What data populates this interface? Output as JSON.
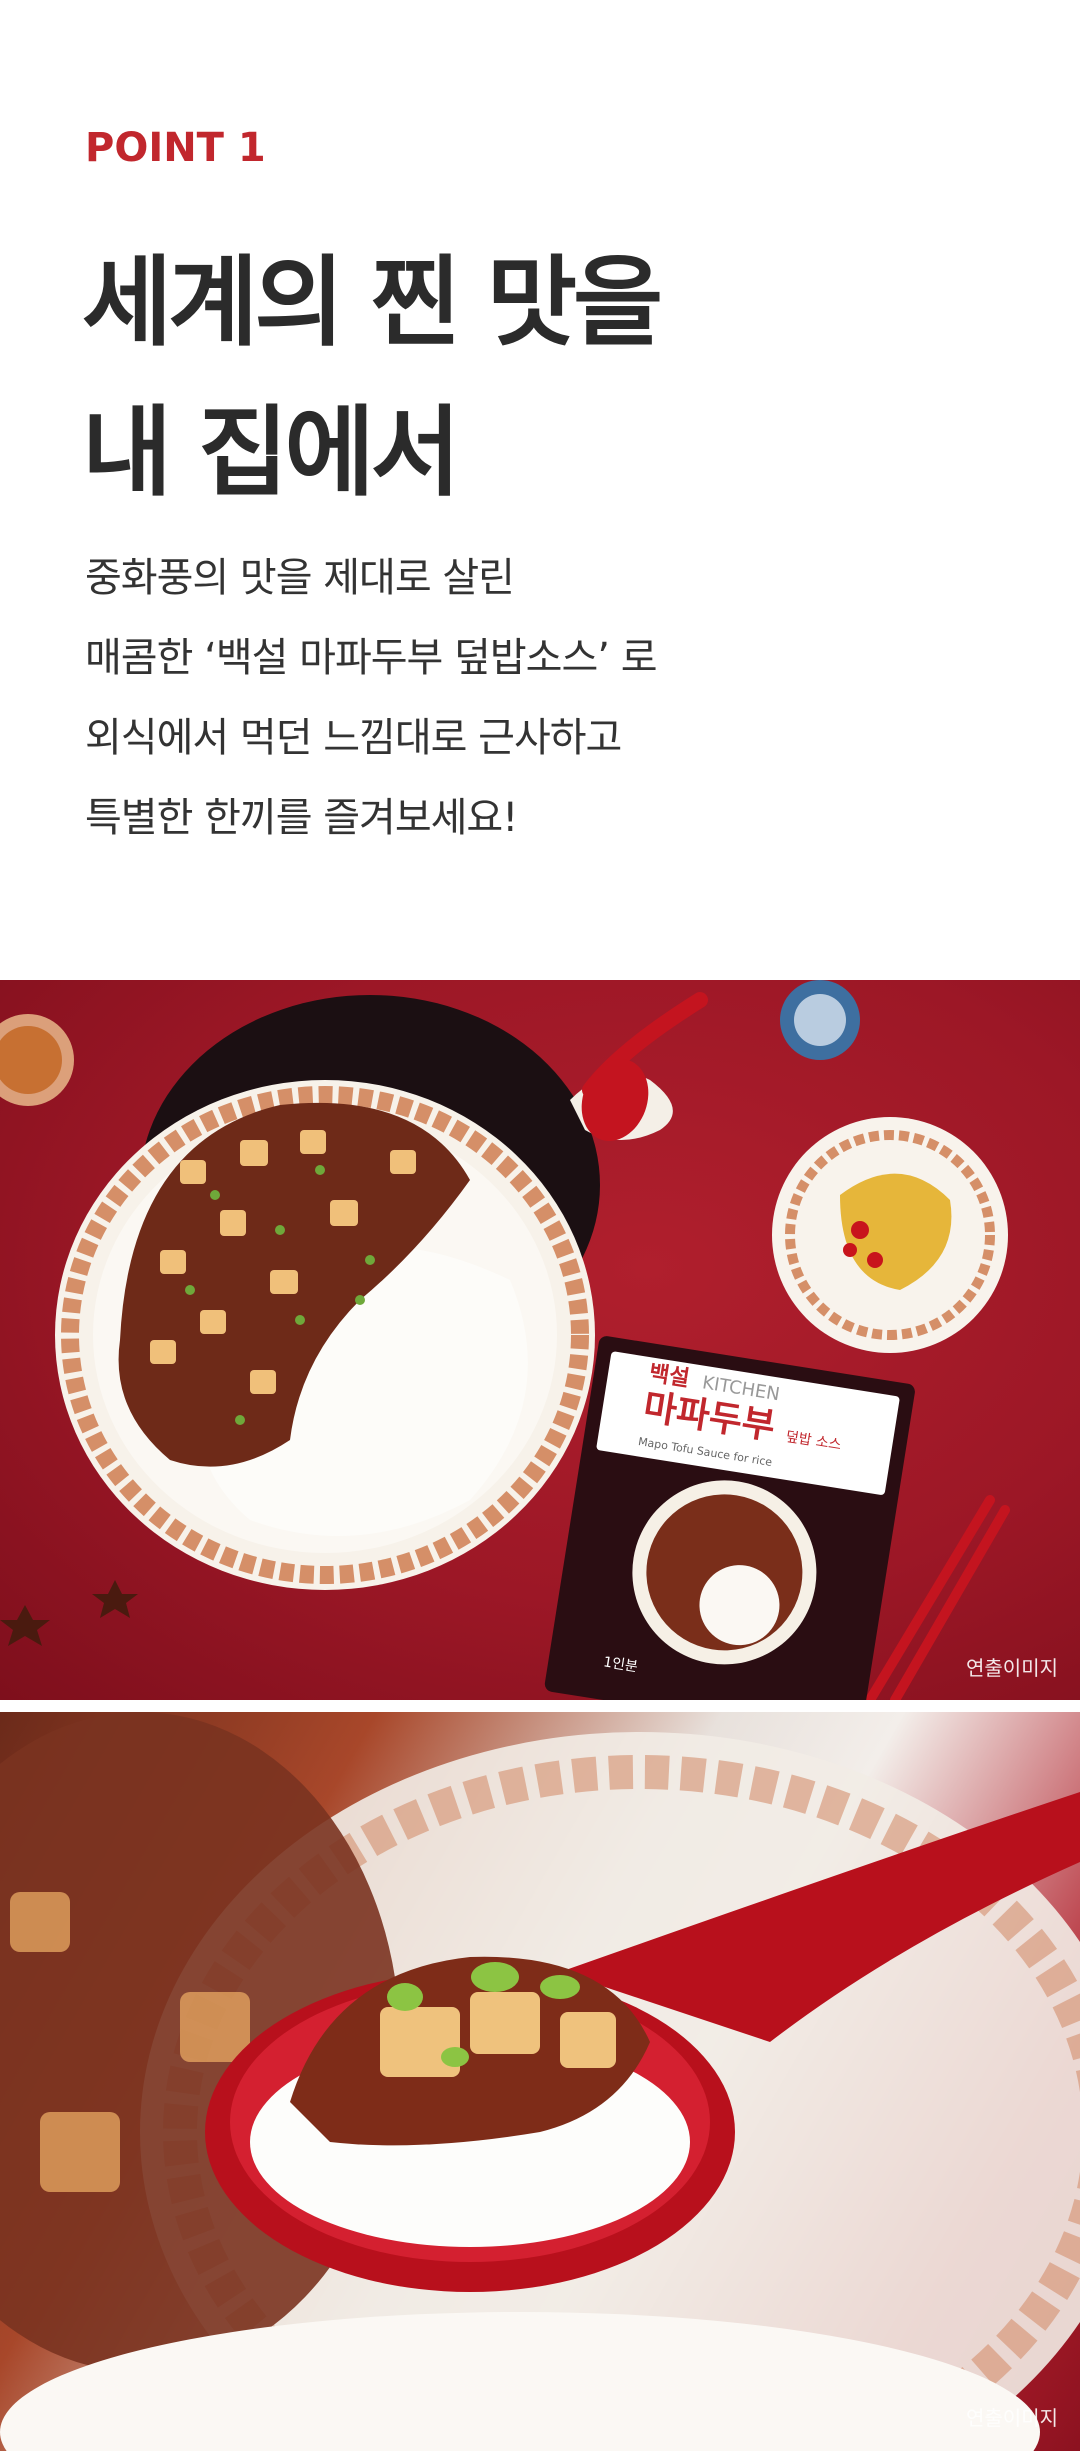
{
  "point": {
    "label": "POINT 1"
  },
  "headline": {
    "line1": "세계의 찐 맛을",
    "line2": "내 집에서"
  },
  "body": {
    "line1": "중화풍의 맛을 제대로 살린",
    "line2": "매콤한 ‘백설 마파두부 덮밥소스’ 로",
    "line3": "외식에서 먹던 느낌대로 근사하고",
    "line4": "특별한 한끼를 즐겨보세요!"
  },
  "product": {
    "brand": "백설",
    "line": "KITCHEN",
    "name": "마파두부",
    "name_suffix": "덮밥 소스",
    "english": "Mapo Tofu Sauce for rice",
    "serving": "1인분"
  },
  "captions": {
    "photo1": "연출이미지",
    "photo2": "연출이미지"
  },
  "colors": {
    "accent": "#c1272d",
    "background_red": "#9c1726",
    "text": "#2b2b2b"
  }
}
